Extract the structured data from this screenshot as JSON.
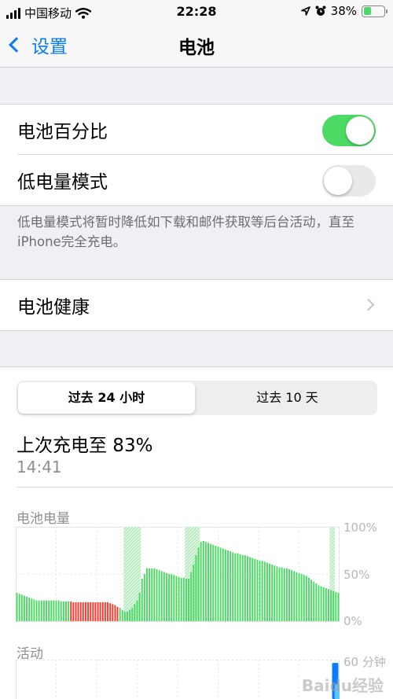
{
  "status_bar": {
    "carrier": "中国移动",
    "time": "22:28",
    "battery_percent": "38%",
    "battery_level": 0.38
  },
  "nav": {
    "back_label": "设置",
    "title": "电池"
  },
  "settings": {
    "battery_percentage": {
      "label": "电池百分比",
      "on": true
    },
    "low_power_mode": {
      "label": "低电量模式",
      "on": false
    },
    "low_power_footnote": "低电量模式将暂时降低如下载和邮件获取等后台活动，直至iPhone完全充电。",
    "battery_health": {
      "label": "电池健康"
    }
  },
  "usage": {
    "segments": [
      "过去 24 小时",
      "过去 10 天"
    ],
    "selected_segment": 0,
    "last_charge_title": "上次充电至 83%",
    "last_charge_time": "14:41",
    "battery_level_label": "电池电量",
    "activity_label": "活动",
    "level_ticks": [
      "100%",
      "50%",
      "0%"
    ],
    "activity_tick": "60 分钟"
  },
  "chart_data": {
    "type": "bar",
    "title": "电池电量",
    "ylim": [
      0,
      100
    ],
    "y_ticks": [
      "0%",
      "50%",
      "100%"
    ],
    "series_colors": {
      "normal": "#4cd964",
      "low_power": "#ff3b30",
      "charging": "#4cd964"
    },
    "values": [
      30,
      29,
      28,
      27,
      26,
      25,
      24,
      23,
      22,
      22,
      22,
      22,
      22,
      22,
      22,
      22,
      22,
      22,
      21,
      21,
      21,
      21,
      21,
      20,
      20,
      20,
      20,
      20,
      20,
      20,
      20,
      20,
      20,
      20,
      20,
      20,
      20,
      20,
      19,
      18,
      17,
      15,
      14,
      12,
      10,
      10,
      12,
      14,
      18,
      22,
      30,
      45,
      50,
      56,
      56,
      56,
      56,
      55,
      54,
      53,
      52,
      51,
      50,
      50,
      49,
      48,
      47,
      46,
      46,
      45,
      45,
      52,
      60,
      70,
      78,
      84,
      85,
      84,
      83,
      82,
      81,
      80,
      79,
      78,
      77,
      76,
      75,
      74,
      73,
      72,
      72,
      71,
      70,
      70,
      69,
      68,
      67,
      66,
      65,
      64,
      64,
      63,
      62,
      61,
      60,
      59,
      58,
      57,
      57,
      56,
      56,
      55,
      54,
      53,
      52,
      51,
      50,
      49,
      48,
      46,
      44,
      42,
      40,
      38,
      37,
      36,
      35,
      34,
      33,
      32,
      31,
      30
    ],
    "low_power_range": [
      22,
      41
    ],
    "charging_ranges": [
      [
        44,
        50
      ],
      [
        69,
        74
      ],
      [
        128,
        129
      ]
    ],
    "activity_values": [
      0,
      0,
      0,
      0,
      0,
      0,
      0,
      0,
      0,
      0,
      0,
      0,
      0,
      0,
      0,
      0,
      0,
      0,
      0,
      0,
      0,
      0,
      0,
      0,
      0,
      0,
      0,
      0,
      0,
      0,
      0,
      0,
      0,
      0,
      0,
      0,
      0,
      0,
      0,
      0,
      0,
      0,
      0,
      0,
      0,
      0,
      0,
      0,
      0,
      0,
      0,
      0,
      0,
      0,
      0,
      0,
      0,
      0,
      0,
      0,
      0,
      0,
      0,
      0,
      0,
      0,
      0,
      0,
      0,
      0,
      0,
      0,
      0,
      0,
      0,
      0,
      0,
      0,
      0,
      0,
      0,
      0,
      0,
      0,
      0,
      0,
      0,
      0,
      0,
      0,
      0,
      0,
      0,
      0,
      0,
      0,
      0,
      0,
      0,
      0,
      0,
      0,
      0,
      0,
      0,
      0,
      0,
      0,
      0,
      0,
      0,
      0,
      0,
      0,
      0,
      0,
      0,
      0,
      0,
      0,
      0,
      0,
      0,
      0,
      0,
      0,
      0,
      55,
      22,
      0
    ],
    "activity_ylim": [
      0,
      60
    ]
  },
  "watermark": "Baidu经验"
}
